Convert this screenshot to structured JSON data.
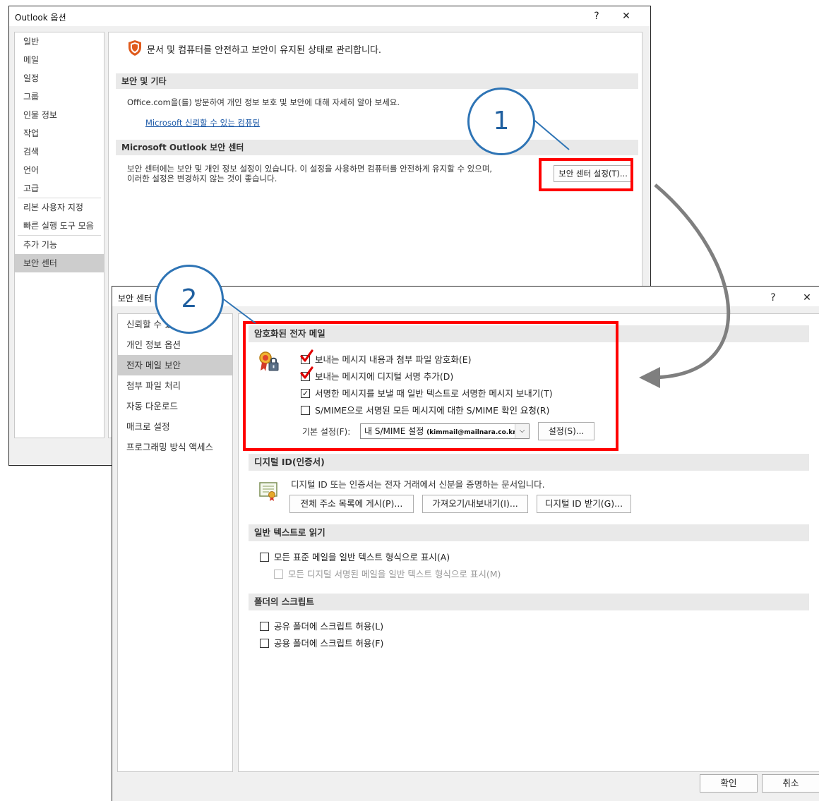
{
  "win1": {
    "title": "Outlook 옵션",
    "help": "?",
    "close": "✕",
    "nav": [
      "일반",
      "메일",
      "일정",
      "그룹",
      "인물 정보",
      "작업",
      "검색",
      "언어",
      "고급",
      "리본 사용자 지정",
      "빠른 실행 도구 모음",
      "추가 기능",
      "보안 센터"
    ],
    "selected_nav": "보안 센터",
    "headline": "문서 및 컴퓨터를 안전하고 보안이 유지된 상태로 관리합니다.",
    "sec1": {
      "title": "보안 및 기타",
      "text": "Office.com을(를) 방문하여 개인 정보 보호 및 보안에 대해 자세히 알아 보세요.",
      "link": "Microsoft 신뢰할 수 있는 컴퓨팅"
    },
    "sec2": {
      "title": "Microsoft Outlook 보안 센터",
      "text1": "보안 센터에는 보안 및 개인 정보 설정이 있습니다. 이 설정을 사용하면 컴퓨터를 안전하게 유지할 수 있으며,",
      "text2": "이러한 설정은 변경하지 않는 것이 좋습니다.",
      "button": "보안 센터 설정(T)..."
    }
  },
  "win2": {
    "title": "보안 센터",
    "help": "?",
    "close": "✕",
    "nav": [
      "신뢰할 수 있는 게시자",
      "개인 정보 옵션",
      "전자 메일 보안",
      "첨부 파일 처리",
      "자동 다운로드",
      "매크로 설정",
      "프로그래밍 방식 액세스"
    ],
    "selected_nav": "전자 메일 보안",
    "encrypted": {
      "title": "암호화된 전자 메일",
      "opt1": "보내는 메시지 내용과 첨부 파일 암호화(E)",
      "opt2": "보내는 메시지에 디지털 서명 추가(D)",
      "opt3": "서명한 메시지를 보낼 때 일반 텍스트로 서명한 메시지 보내기(T)",
      "opt4": "S/MIME으로 서명된 모든 메시지에 대한 S/MIME 확인 요청(R)",
      "default_label": "기본 설정(F):",
      "default_value": "내 S/MIME 설정",
      "default_email": "(kimmail@mailnara.co.kr)",
      "settings_btn": "설정(S)..."
    },
    "digital_id": {
      "title": "디지털 ID(인증서)",
      "text": "디지털 ID 또는 인증서는 전자 거래에서 신분을 증명하는 문서입니다.",
      "btn1": "전체 주소 목록에 게시(P)...",
      "btn2": "가져오기/내보내기(I)...",
      "btn3": "디지털 ID 받기(G)..."
    },
    "plain_text": {
      "title": "일반 텍스트로 읽기",
      "opt1": "모든 표준 메일을 일반 텍스트 형식으로 표시(A)",
      "opt2": "모든 디지털 서명된 메일을 일반 텍스트 형식으로 표시(M)"
    },
    "scripts": {
      "title": "폴더의 스크립트",
      "opt1": "공유 폴더에 스크립트 허용(L)",
      "opt2": "공용 폴더에 스크립트 허용(F)"
    },
    "ok": "확인",
    "cancel": "취소"
  },
  "callouts": {
    "one": "1",
    "two": "2"
  },
  "colors": {
    "highlight": "#ff0000",
    "callout": "#2e74b5",
    "arrow": "#7f7f7f"
  }
}
